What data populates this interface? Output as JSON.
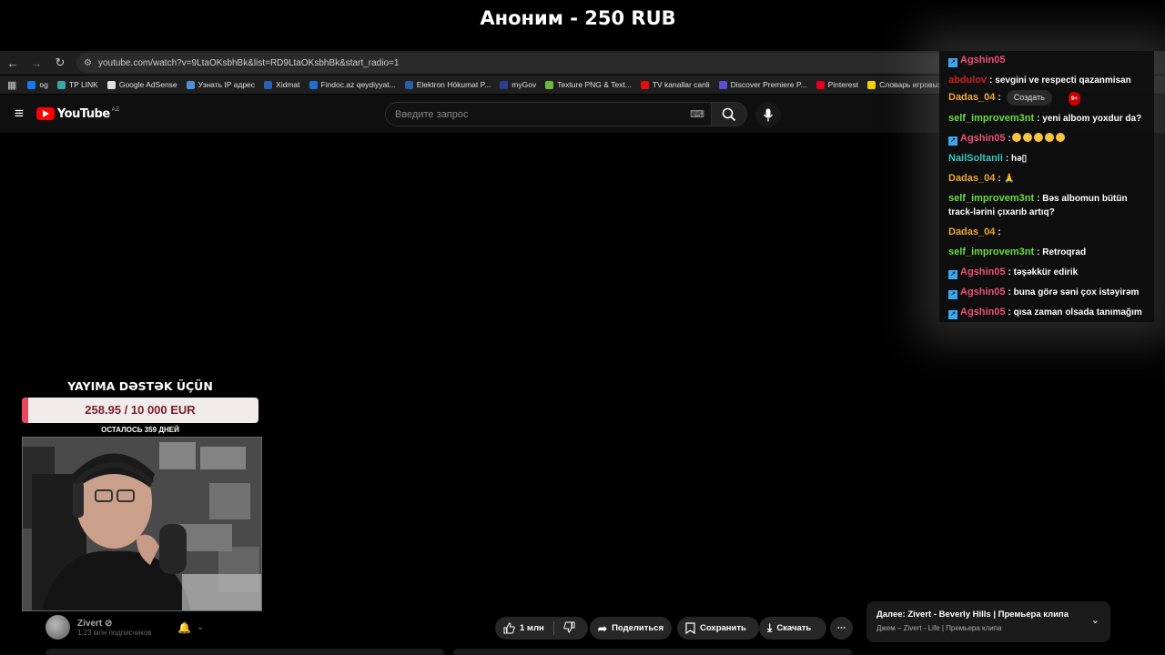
{
  "donation_alert": "Аноним - 250 RUB",
  "browser": {
    "url": "youtube.com/watch?v=9LtaOKsbhBk&list=RD9LtaOKsbhBk&start_radio=1",
    "bookmarks": [
      {
        "label": "og",
        "color": "#1877f2"
      },
      {
        "label": "TP LINK",
        "color": "#3aa6a6"
      },
      {
        "label": "Google AdSense",
        "color": "#e0e0e0"
      },
      {
        "label": "Узнать IP адрес",
        "color": "#4a90d9"
      },
      {
        "label": "Xidmat",
        "color": "#2c5fb0"
      },
      {
        "label": "Findoc.az qeydiyyat...",
        "color": "#1d6fd1"
      },
      {
        "label": "Elektron Hökumat P...",
        "color": "#2b5ea8"
      },
      {
        "label": "myGov",
        "color": "#2a3f8f"
      },
      {
        "label": "Texture PNG & Text...",
        "color": "#6bb83a"
      },
      {
        "label": "TV kanallar canli",
        "color": "#e01010"
      },
      {
        "label": "Discover Premiere P...",
        "color": "#5b4fd6"
      },
      {
        "label": "Pinterest",
        "color": "#e60023"
      },
      {
        "label": "Словарь игровых т...",
        "color": "#f2d100"
      }
    ]
  },
  "youtube": {
    "country": "AZ",
    "search_placeholder": "Введите запрос"
  },
  "chat": {
    "messages": [
      {
        "user": "Agshin05",
        "user_color": "#ef4f7a",
        "badge": true,
        "text": "",
        "emoji_count": 0
      },
      {
        "user": "abdulov",
        "user_color": "#cc2222",
        "badge": false,
        "text": ": sevgini ve respecti qazanmisan",
        "emoji_count": 0
      },
      {
        "user": "Dadas_04",
        "user_color": "#f0a733",
        "badge": false,
        "text": ":",
        "emoji_count": 0,
        "create_label": "Создать",
        "notif": "9+"
      },
      {
        "user": "self_improvem3nt",
        "user_color": "#6bdc44",
        "badge": false,
        "text": ": yeni albom yoxdur da?",
        "emoji_count": 0
      },
      {
        "user": "Agshin05",
        "user_color": "#ef4f7a",
        "badge": true,
        "text": ":",
        "emoji_count": 5
      },
      {
        "user": "NailSoltanli",
        "user_color": "#36c7b8",
        "badge": false,
        "text": ": hə▯",
        "emoji_count": 0
      },
      {
        "user": "Dadas_04",
        "user_color": "#f0a733",
        "badge": false,
        "text": ": 🙏",
        "emoji_count": 0
      },
      {
        "user": "self_improvem3nt",
        "user_color": "#6bdc44",
        "badge": false,
        "text": ": Bəs albomun bütün track-lərini çıxarıb artıq?",
        "emoji_count": 0
      },
      {
        "user": "Dadas_04",
        "user_color": "#f0a733",
        "badge": false,
        "text": ":",
        "emoji_count": 0
      },
      {
        "user": "self_improvem3nt",
        "user_color": "#6bdc44",
        "badge": false,
        "text": ": Retroqrad",
        "emoji_count": 0
      },
      {
        "user": "Agshin05",
        "user_color": "#ef4f7a",
        "badge": true,
        "text": ": təşəkkür edirik",
        "emoji_count": 0
      },
      {
        "user": "Agshin05",
        "user_color": "#ef4f7a",
        "badge": true,
        "text": ": buna görə səni çox istəyirəm",
        "emoji_count": 0
      },
      {
        "user": "Agshin05",
        "user_color": "#ef4f7a",
        "badge": true,
        "text": ": qısa zaman olsada tanımağım",
        "emoji_count": 0
      }
    ]
  },
  "donation_goal": {
    "title": "YAYIMA DƏSTƏK ÜÇÜN",
    "amount_text": "258.95 / 10 000 EUR",
    "progress": 0.0259,
    "days_left": "ОСТАЛОСЬ 359 ДНЕЙ"
  },
  "channel": {
    "name": "Zivert ⊘",
    "subscribers": "1,23 млн подписчиков"
  },
  "actions": {
    "likes": "1 млн",
    "share": "Поделиться",
    "save": "Сохранить",
    "download": "Скачать"
  },
  "up_next": {
    "title": "Далее: Zivert - Beverly Hills | Премьера клипа",
    "subtitle": "Джем – Zivert - Life | Премьера клипа"
  }
}
